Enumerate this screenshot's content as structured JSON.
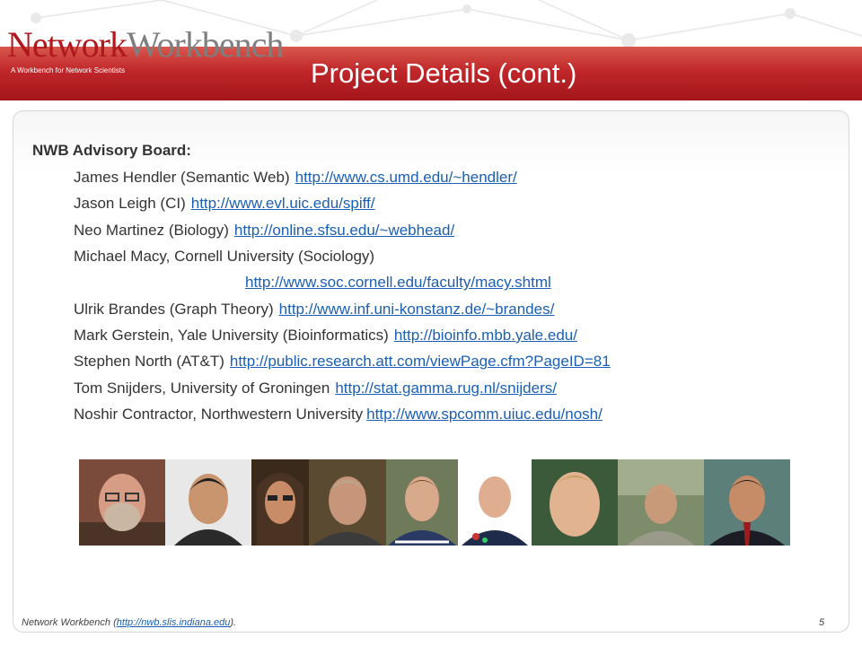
{
  "header": {
    "logo_part1": "Network",
    "logo_part2": "Workbench",
    "logo_tagline": "A Workbench for Network Scientists",
    "title": "Project Details (cont.)"
  },
  "content": {
    "heading": "NWB Advisory Board:",
    "members": [
      {
        "text": "James Hendler (Semantic Web)",
        "link": "http://www.cs.umd.edu/~hendler/"
      },
      {
        "text": "Jason Leigh (CI)",
        "link": "http://www.evl.uic.edu/spiff/"
      },
      {
        "text": "Neo Martinez (Biology)",
        "link": "http://online.sfsu.edu/~webhead/"
      },
      {
        "text": "Michael Macy, Cornell University (Sociology)",
        "link": "http://www.soc.cornell.edu/faculty/macy.shtml"
      },
      {
        "text": "Ulrik Brandes (Graph Theory)",
        "link": "http://www.inf.uni-konstanz.de/~brandes/"
      },
      {
        "text": "Mark Gerstein, Yale University (Bioinformatics)",
        "link": "http://bioinfo.mbb.yale.edu/"
      },
      {
        "text": "Stephen North (AT&T)",
        "link": "http://public.research.att.com/viewPage.cfm?PageID=81"
      },
      {
        "text": "Tom Snijders, University of Groningen",
        "link": "http://stat.gamma.rug.nl/snijders/"
      },
      {
        "text": "Noshir Contractor, Northwestern University",
        "link": "http://www.spcomm.uiuc.edu/nosh/"
      }
    ]
  },
  "footer": {
    "text_before": "Network Workbench (",
    "link": "http://nwb.slis.indiana.edu",
    "text_after": ").",
    "page_number": "5"
  },
  "colors": {
    "header_red": "#c0272a",
    "link_blue": "#1a5fb4",
    "body_text": "#333333"
  }
}
